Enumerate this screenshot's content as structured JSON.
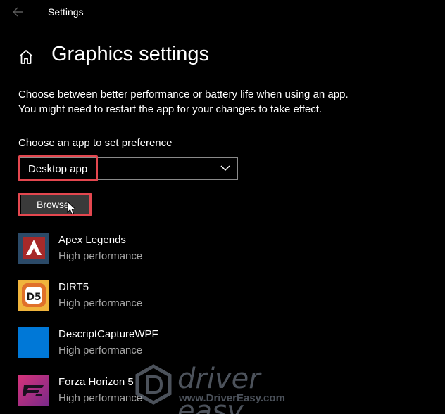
{
  "window": {
    "title": "Settings"
  },
  "page": {
    "title": "Graphics settings",
    "description_line1": "Choose between better performance or battery life when using an app.",
    "description_line2": "You might need to restart the app for your changes to take effect."
  },
  "preference": {
    "label": "Choose an app to set preference",
    "selected": "Desktop app",
    "browse_label": "Browse"
  },
  "apps": [
    {
      "name": "Apex Legends",
      "preference": "High performance",
      "icon": "apex-legends-icon"
    },
    {
      "name": "DIRT5",
      "preference": "High performance",
      "icon": "dirt5-icon"
    },
    {
      "name": "DescriptCaptureWPF",
      "preference": "High performance",
      "icon": "descript-capture-icon"
    },
    {
      "name": "Forza Horizon 5",
      "preference": "High performance",
      "icon": "forza-horizon-5-icon"
    }
  ],
  "watermark": {
    "brand": "driver easy",
    "url": "www.DriverEasy.com"
  },
  "colors": {
    "background": "#000000",
    "highlight": "#e4474f",
    "secondary_text": "#a6a6a6",
    "accent_blue": "#0078d7"
  }
}
